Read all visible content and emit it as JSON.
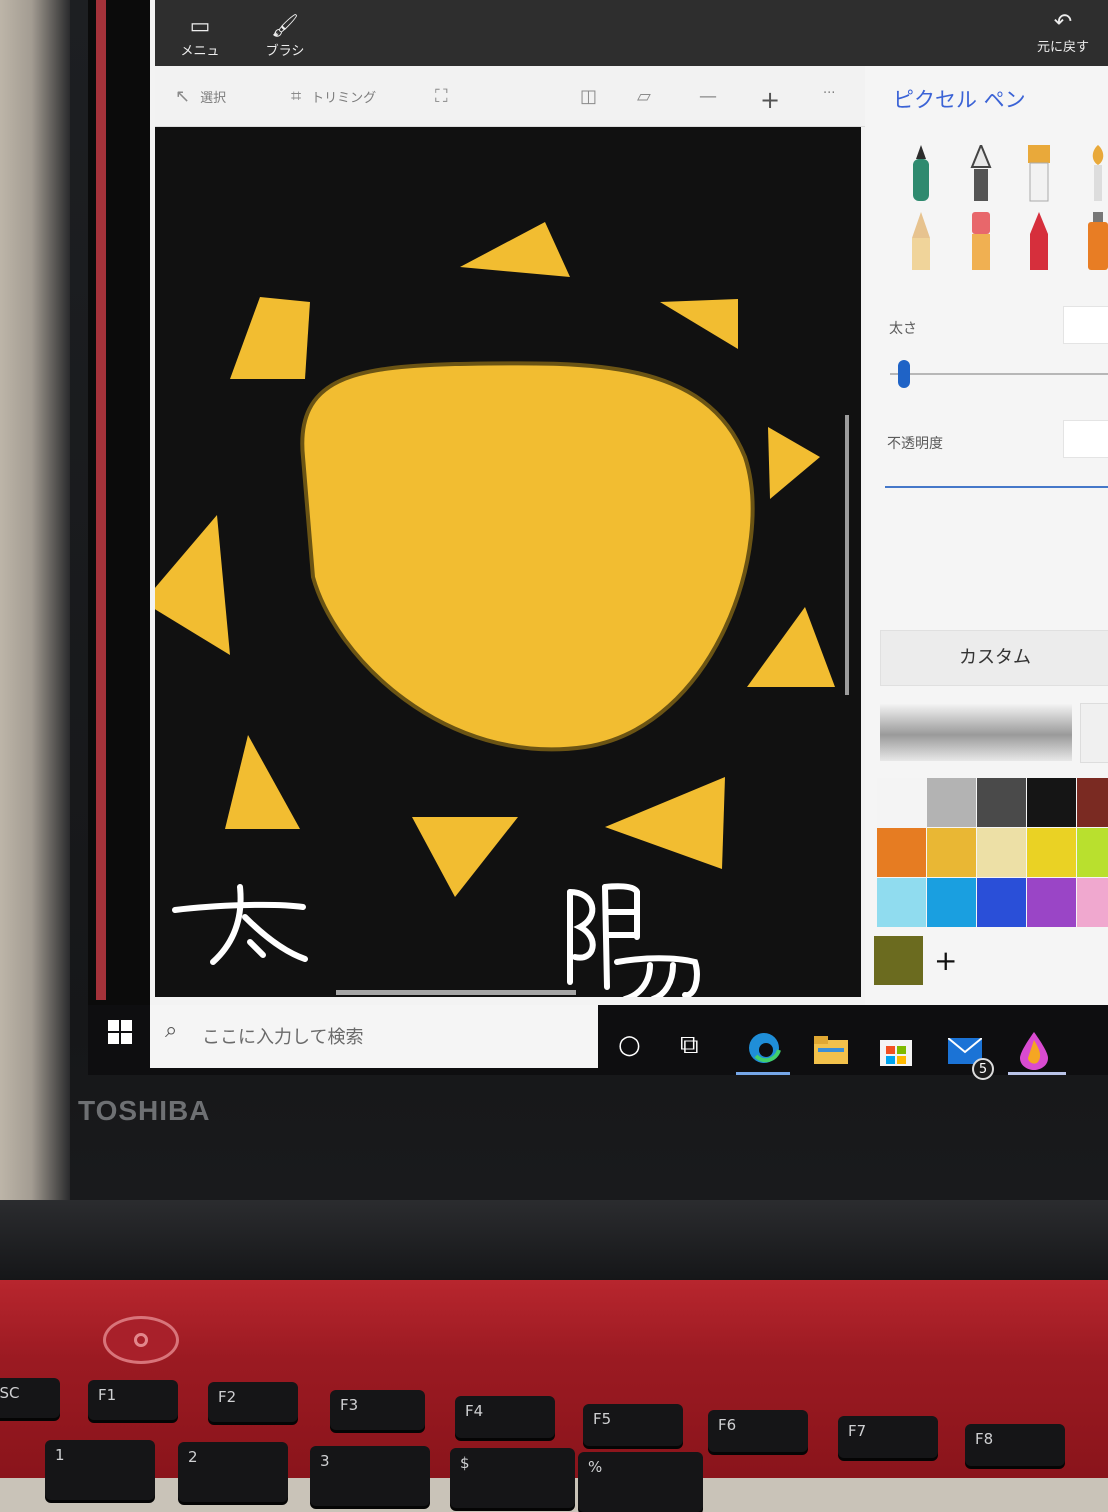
{
  "brand": "TOSHIBA",
  "titlebar": {
    "menu_label": "メニュー",
    "brush_label": "ブラシ",
    "undo_label": "元に戻す",
    "menu_icon": "menu-icon",
    "brush_icon": "brush-icon",
    "undo_icon": "undo-icon"
  },
  "toolbar": {
    "select_label": "選択",
    "crop_label": "トリミング",
    "more_label": "···"
  },
  "panel": {
    "title": "ピクセル ペン",
    "thickness_label": "太さ",
    "opacity_label": "不透明度",
    "custom_label": "カスタム",
    "add_color_label": "+",
    "palette": [
      [
        "#f4f4f4",
        "#b3b3b3",
        "#4a4a4a",
        "#151515",
        "#7a2a22"
      ],
      [
        "#e67c22",
        "#e9b734",
        "#ede0a6",
        "#ead224",
        "#b9e02e"
      ],
      [
        "#90dcef",
        "#1a9fe0",
        "#2a4fd8",
        "#9a45c6",
        "#f0a8cf"
      ]
    ],
    "current_color": "#6b6b1f"
  },
  "canvas": {
    "background": "#111111",
    "sun_color": "#f2bd31",
    "handwritten_text": "太陽"
  },
  "taskbar": {
    "search_placeholder": "ここに入力して検索",
    "mail_badge": "5"
  },
  "keyboard": {
    "keys": [
      "ESC",
      "F1",
      "F2",
      "F3",
      "F4",
      "F5",
      "F6",
      "F7",
      "F8",
      "1",
      "2",
      "3",
      "$",
      "%"
    ]
  }
}
